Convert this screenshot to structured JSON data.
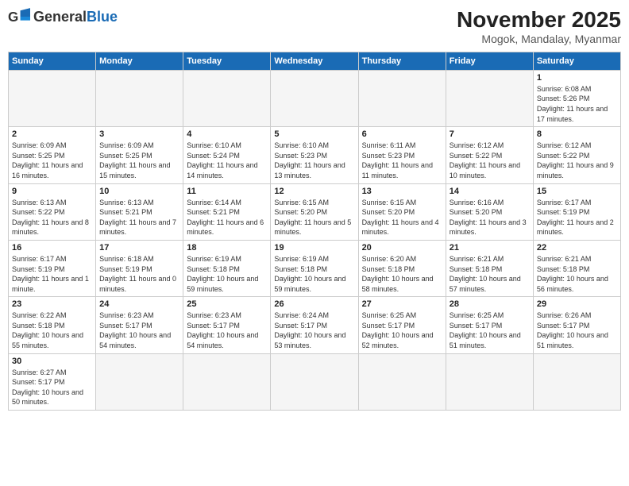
{
  "header": {
    "logo_general": "General",
    "logo_blue": "Blue",
    "month_title": "November 2025",
    "location": "Mogok, Mandalay, Myanmar"
  },
  "weekdays": [
    "Sunday",
    "Monday",
    "Tuesday",
    "Wednesday",
    "Thursday",
    "Friday",
    "Saturday"
  ],
  "days": [
    {
      "num": "",
      "info": ""
    },
    {
      "num": "",
      "info": ""
    },
    {
      "num": "",
      "info": ""
    },
    {
      "num": "",
      "info": ""
    },
    {
      "num": "",
      "info": ""
    },
    {
      "num": "",
      "info": ""
    },
    {
      "num": "1",
      "info": "Sunrise: 6:08 AM\nSunset: 5:26 PM\nDaylight: 11 hours and 17 minutes."
    },
    {
      "num": "2",
      "info": "Sunrise: 6:09 AM\nSunset: 5:25 PM\nDaylight: 11 hours and 16 minutes."
    },
    {
      "num": "3",
      "info": "Sunrise: 6:09 AM\nSunset: 5:25 PM\nDaylight: 11 hours and 15 minutes."
    },
    {
      "num": "4",
      "info": "Sunrise: 6:10 AM\nSunset: 5:24 PM\nDaylight: 11 hours and 14 minutes."
    },
    {
      "num": "5",
      "info": "Sunrise: 6:10 AM\nSunset: 5:23 PM\nDaylight: 11 hours and 13 minutes."
    },
    {
      "num": "6",
      "info": "Sunrise: 6:11 AM\nSunset: 5:23 PM\nDaylight: 11 hours and 11 minutes."
    },
    {
      "num": "7",
      "info": "Sunrise: 6:12 AM\nSunset: 5:22 PM\nDaylight: 11 hours and 10 minutes."
    },
    {
      "num": "8",
      "info": "Sunrise: 6:12 AM\nSunset: 5:22 PM\nDaylight: 11 hours and 9 minutes."
    },
    {
      "num": "9",
      "info": "Sunrise: 6:13 AM\nSunset: 5:22 PM\nDaylight: 11 hours and 8 minutes."
    },
    {
      "num": "10",
      "info": "Sunrise: 6:13 AM\nSunset: 5:21 PM\nDaylight: 11 hours and 7 minutes."
    },
    {
      "num": "11",
      "info": "Sunrise: 6:14 AM\nSunset: 5:21 PM\nDaylight: 11 hours and 6 minutes."
    },
    {
      "num": "12",
      "info": "Sunrise: 6:15 AM\nSunset: 5:20 PM\nDaylight: 11 hours and 5 minutes."
    },
    {
      "num": "13",
      "info": "Sunrise: 6:15 AM\nSunset: 5:20 PM\nDaylight: 11 hours and 4 minutes."
    },
    {
      "num": "14",
      "info": "Sunrise: 6:16 AM\nSunset: 5:20 PM\nDaylight: 11 hours and 3 minutes."
    },
    {
      "num": "15",
      "info": "Sunrise: 6:17 AM\nSunset: 5:19 PM\nDaylight: 11 hours and 2 minutes."
    },
    {
      "num": "16",
      "info": "Sunrise: 6:17 AM\nSunset: 5:19 PM\nDaylight: 11 hours and 1 minute."
    },
    {
      "num": "17",
      "info": "Sunrise: 6:18 AM\nSunset: 5:19 PM\nDaylight: 11 hours and 0 minutes."
    },
    {
      "num": "18",
      "info": "Sunrise: 6:19 AM\nSunset: 5:18 PM\nDaylight: 10 hours and 59 minutes."
    },
    {
      "num": "19",
      "info": "Sunrise: 6:19 AM\nSunset: 5:18 PM\nDaylight: 10 hours and 59 minutes."
    },
    {
      "num": "20",
      "info": "Sunrise: 6:20 AM\nSunset: 5:18 PM\nDaylight: 10 hours and 58 minutes."
    },
    {
      "num": "21",
      "info": "Sunrise: 6:21 AM\nSunset: 5:18 PM\nDaylight: 10 hours and 57 minutes."
    },
    {
      "num": "22",
      "info": "Sunrise: 6:21 AM\nSunset: 5:18 PM\nDaylight: 10 hours and 56 minutes."
    },
    {
      "num": "23",
      "info": "Sunrise: 6:22 AM\nSunset: 5:18 PM\nDaylight: 10 hours and 55 minutes."
    },
    {
      "num": "24",
      "info": "Sunrise: 6:23 AM\nSunset: 5:17 PM\nDaylight: 10 hours and 54 minutes."
    },
    {
      "num": "25",
      "info": "Sunrise: 6:23 AM\nSunset: 5:17 PM\nDaylight: 10 hours and 54 minutes."
    },
    {
      "num": "26",
      "info": "Sunrise: 6:24 AM\nSunset: 5:17 PM\nDaylight: 10 hours and 53 minutes."
    },
    {
      "num": "27",
      "info": "Sunrise: 6:25 AM\nSunset: 5:17 PM\nDaylight: 10 hours and 52 minutes."
    },
    {
      "num": "28",
      "info": "Sunrise: 6:25 AM\nSunset: 5:17 PM\nDaylight: 10 hours and 51 minutes."
    },
    {
      "num": "29",
      "info": "Sunrise: 6:26 AM\nSunset: 5:17 PM\nDaylight: 10 hours and 51 minutes."
    },
    {
      "num": "30",
      "info": "Sunrise: 6:27 AM\nSunset: 5:17 PM\nDaylight: 10 hours and 50 minutes."
    },
    {
      "num": "",
      "info": ""
    },
    {
      "num": "",
      "info": ""
    },
    {
      "num": "",
      "info": ""
    },
    {
      "num": "",
      "info": ""
    },
    {
      "num": "",
      "info": ""
    },
    {
      "num": "",
      "info": ""
    }
  ],
  "colors": {
    "header_bg": "#1a6bb5",
    "logo_blue": "#1a6bb5"
  }
}
